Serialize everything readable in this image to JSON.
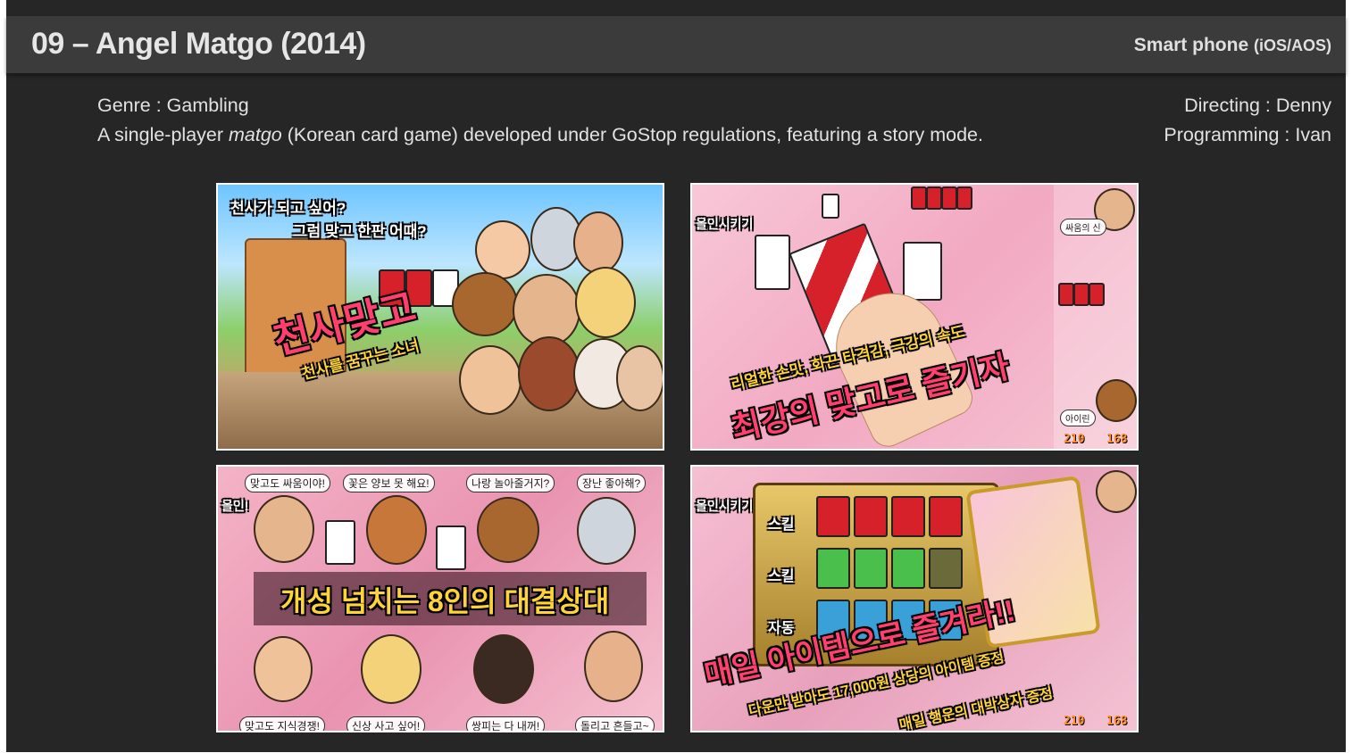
{
  "header": {
    "title": "09 – Angel Matgo (2014)",
    "platform": "Smart phone",
    "platform_sub": "(iOS/AOS)"
  },
  "info": {
    "genre": "Genre : Gambling",
    "description_pre": "A single-player ",
    "description_em": "matgo",
    "description_post": " (Korean card game) developed under GoStop regulations, featuring a story mode.",
    "directing": "Directing : Denny",
    "programming": "Programming : Ivan"
  },
  "screenshots": {
    "shot1": {
      "line1": "천사가 되고 싶어?",
      "line2": "그럼 맞고 한판 어때?",
      "logo": "천사맞고",
      "logo_sub": "천사를 꿈꾸는 소녀"
    },
    "shot2": {
      "top_label": "올인시키기",
      "caption_small": "리얼한 손맛, 화끈 타격감, 극강의 속도",
      "caption_main": "최강의 맞고로 즐기자",
      "player_name": "싸움의 신",
      "opponent_name": "아이린",
      "score_left": "210",
      "score_right": "168"
    },
    "shot3": {
      "top_label": "올인!",
      "bubble1": "맞고도 싸움이야!",
      "bubble2": "꽃은 양보 못 해요!",
      "bubble3": "나랑 놀아줄거지?",
      "bubble4": "장난 좋아해?",
      "bubble5": "맞고도 지식경쟁!",
      "bubble6": "신상 사고 싶어!",
      "bubble7": "쌍피는 다 내꺼!",
      "bubble8": "돌리고 흔들고~",
      "caption": "개성 넘치는 8인의 대결상대"
    },
    "shot4": {
      "top_label": "올인시키기",
      "row1_label": "스킬",
      "row2_label": "스킬",
      "row3_label": "자동",
      "caption_main": "매일 아이템으로 즐겨라!!",
      "caption_sub1": "다운만 받아도 17,000원 상당의 아이템 증정",
      "caption_sub2": "매일 행운의 대박상자 증정",
      "score_left": "210",
      "score_right": "168"
    }
  }
}
